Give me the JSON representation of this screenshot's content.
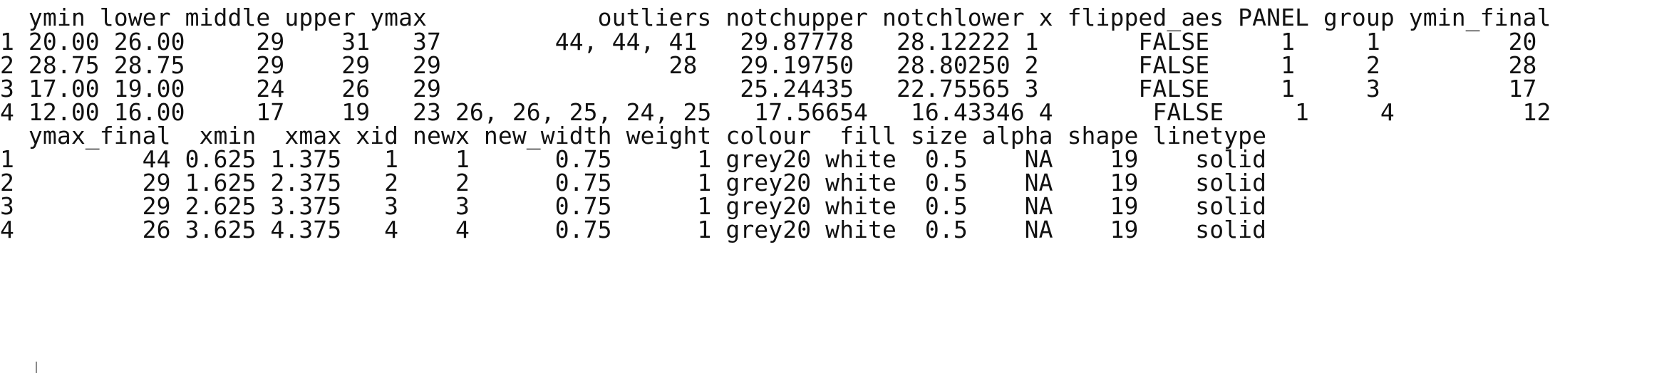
{
  "console": {
    "prompt_echo": "  ─ ─  ─ ─  ─ ─ ─ ─ ─ ─  ─ ─ ─ ─",
    "block1": {
      "header": "  ymin lower middle upper ymax            outliers notchupper notchlower x flipped_aes PANEL group ymin_final",
      "rows": [
        "1 20.00 26.00     29    31   37        44, 44, 41   29.87778   28.12222 1       FALSE     1     1         20",
        "2 28.75 28.75     29    29   29                28   29.19750   28.80250 2       FALSE     1     2         28",
        "3 17.00 19.00     24    26   29                     25.24435   22.75565 3       FALSE     1     3         17",
        "4 12.00 16.00     17    19   23 26, 26, 25, 24, 25   17.56654   16.43346 4       FALSE     1     4         12"
      ]
    },
    "block2": {
      "header": "  ymax_final  xmin  xmax xid newx new_width weight colour  fill size alpha shape linetype",
      "rows": [
        "1         44 0.625 1.375   1    1      0.75      1 grey20 white  0.5    NA    19    solid",
        "2         29 1.625 2.375   2    2      0.75      1 grey20 white  0.5    NA    19    solid",
        "3         29 2.625 3.375   3    3      0.75      1 grey20 white  0.5    NA    19    solid",
        "4         26 3.625 4.375   4    4      0.75      1 grey20 white  0.5    NA    19    solid"
      ]
    }
  }
}
